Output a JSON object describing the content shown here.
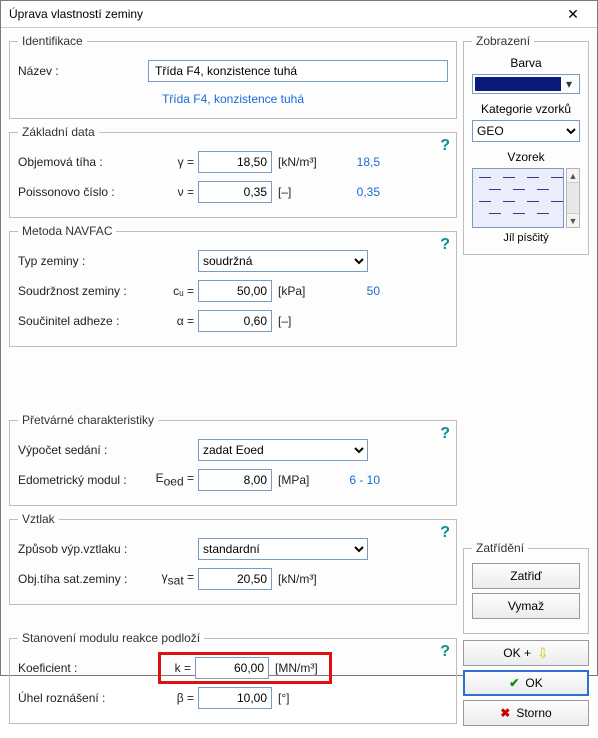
{
  "window": {
    "title": "Úprava vlastností zeminy"
  },
  "ident": {
    "legend": "Identifikace",
    "name_label": "Název :",
    "name_value": "Třída F4, konzistence tuhá",
    "subtitle": "Třída F4, konzistence tuhá"
  },
  "basic": {
    "legend": "Základní data",
    "weight_label": "Objemová tíha :",
    "weight_sym": "γ =",
    "weight_val": "18,50",
    "weight_unit": "[kN/m³]",
    "weight_hint": "18,5",
    "poisson_label": "Poissonovo číslo :",
    "poisson_sym": "ν =",
    "poisson_val": "0,35",
    "poisson_unit": "[–]",
    "poisson_hint": "0,35"
  },
  "navfac": {
    "legend": "Metoda NAVFAC",
    "type_label": "Typ zeminy :",
    "type_val": "soudržná",
    "cohesion_label": "Soudržnost zeminy :",
    "cohesion_sym": "cᵤ =",
    "cohesion_val": "50,00",
    "cohesion_unit": "[kPa]",
    "cohesion_hint": "50",
    "adh_label": "Součinitel adheze :",
    "adh_sym": "α =",
    "adh_val": "0,60",
    "adh_unit": "[–]"
  },
  "deform": {
    "legend": "Přetvárné charakteristiky",
    "calc_label": "Výpočet sedání :",
    "calc_val": "zadat Eoed",
    "eoed_label": "Edometrický modul :",
    "eoed_sym": "E",
    "eoed_sub": "oed",
    "eoed_eq": " =",
    "eoed_val": "8,00",
    "eoed_unit": "[MPa]",
    "eoed_hint": "6 - 10"
  },
  "uplift": {
    "legend": "Vztlak",
    "method_label": "Způsob výp.vztlaku :",
    "method_val": "standardní",
    "sat_label": "Obj.tíha sat.zeminy :",
    "sat_sym": "γ",
    "sat_sub": "sat",
    "sat_eq": " =",
    "sat_val": "20,50",
    "sat_unit": "[kN/m³]"
  },
  "modk": {
    "legend": "Stanovení modulu reakce podloží",
    "k_label": "Koeficient :",
    "k_sym": "k =",
    "k_val": "60,00",
    "k_unit": "[MN/m³]",
    "beta_label": "Úhel roznášení :",
    "beta_sym": "β =",
    "beta_val": "10,00",
    "beta_unit": "[°]"
  },
  "display": {
    "legend": "Zobrazení",
    "color_label": "Barva",
    "cat_label": "Kategorie vzorků",
    "cat_val": "GEO",
    "sample_label": "Vzorek",
    "sample_caption": "Jíl písčitý"
  },
  "classify": {
    "legend": "Zatřídění",
    "btn_classify": "Zatřiď",
    "btn_clear": "Vymaž"
  },
  "buttons": {
    "ok_plus": "OK +",
    "ok": "OK",
    "cancel": "Storno"
  }
}
